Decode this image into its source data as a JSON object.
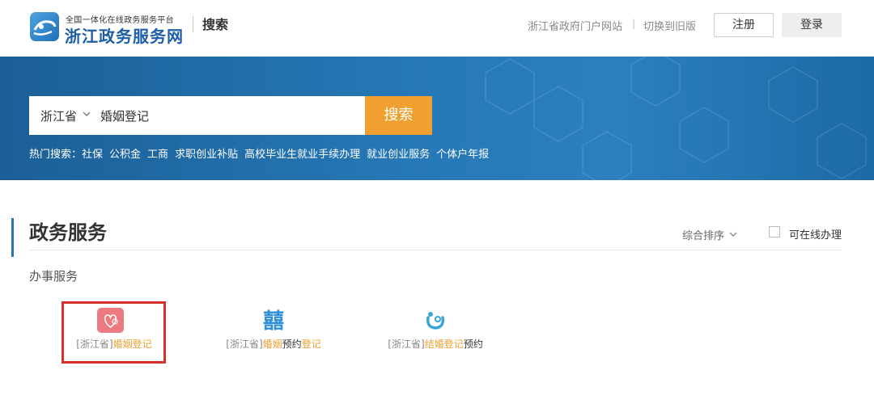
{
  "header": {
    "brand_small": "全国一体化在线政务服务平台",
    "brand_big": "浙江政务服务网",
    "page_label": "搜索",
    "link_portal": "浙江省政府门户网站",
    "link_separator": "|",
    "link_old": "切换到旧版",
    "register_label": "注册",
    "login_label": "登录"
  },
  "search": {
    "region": "浙江省",
    "query": "婚姻登记",
    "button_label": "搜索",
    "hot_prefix": "热门搜索：",
    "hot_terms": [
      "社保",
      "公积金",
      "工商",
      "求职创业补贴",
      "高校毕业生就业手续办理",
      "就业创业服务",
      "个体户年报"
    ]
  },
  "main": {
    "section_title": "政务服务",
    "sort_label": "综合排序",
    "online_label": "可在线办理",
    "subsection_title": "办事服务",
    "services": [
      {
        "prefix": "[浙江省]",
        "name": "婚姻登记",
        "extra": ""
      },
      {
        "prefix": "[浙江省]",
        "name": "婚姻",
        "extra": "预约",
        "name2": "登记"
      },
      {
        "prefix": "[浙江省]",
        "name": "结婚登记",
        "extra": "预约"
      }
    ]
  },
  "colors": {
    "brand_blue": "#1e5ea8",
    "banner_blue": "#2577b5",
    "accent_orange": "#f0a030",
    "highlight_red": "#d8302a"
  },
  "icons": [
    "logo-icon",
    "chevron-down-icon",
    "heart-icon",
    "double-happiness-icon",
    "rings-icon"
  ]
}
